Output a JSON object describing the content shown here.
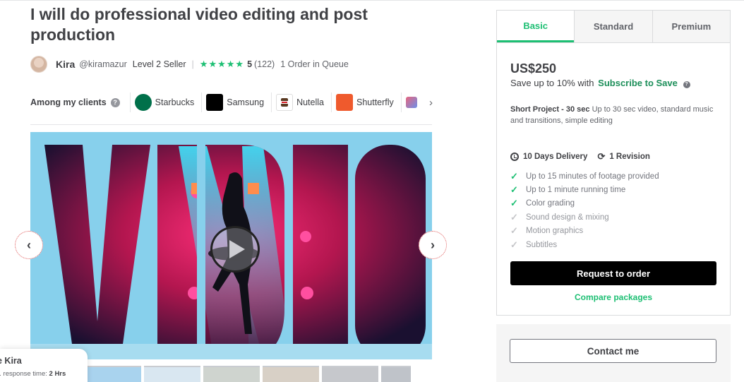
{
  "gig": {
    "title": "I will do professional video editing and post production"
  },
  "seller": {
    "name": "Kira",
    "handle": "@kiramazur",
    "level": "Level 2 Seller",
    "rating_stars": 5,
    "rating": "5",
    "reviews": "(122)",
    "queue": "1 Order in Queue"
  },
  "clients": {
    "label": "Among my clients",
    "items": [
      {
        "name": "Starbucks",
        "icon": "starbucks-logo"
      },
      {
        "name": "Samsung",
        "icon": "samsung-logo"
      },
      {
        "name": "Nutella",
        "icon": "nutella-logo"
      },
      {
        "name": "Shutterfly",
        "icon": "shutterfly-logo"
      }
    ]
  },
  "gallery": {
    "hero_word": "VIDEO"
  },
  "contact_card": {
    "name": "e Kira",
    "response_label": "g. response time:",
    "response_value": "2 Hrs"
  },
  "packages": {
    "tabs": [
      {
        "label": "Basic",
        "active": true
      },
      {
        "label": "Standard",
        "active": false
      },
      {
        "label": "Premium",
        "active": false
      }
    ],
    "price": "US$250",
    "save_prefix": "Save up to 10% with",
    "save_link": "Subscribe to Save",
    "title": "Short Project - 30 sec",
    "description": "Up to 30 sec video, standard music and transitions, simple editing",
    "delivery": "10 Days Delivery",
    "revisions": "1 Revision",
    "features": [
      {
        "label": "Up to 15 minutes of footage provided",
        "included": true
      },
      {
        "label": "Up to 1 minute running time",
        "included": true
      },
      {
        "label": "Color grading",
        "included": true
      },
      {
        "label": "Sound design & mixing",
        "included": false
      },
      {
        "label": "Motion graphics",
        "included": false
      },
      {
        "label": "Subtitles",
        "included": false
      }
    ],
    "order_button": "Request to order",
    "compare_link": "Compare packages"
  },
  "contact": {
    "button": "Contact me"
  },
  "colors": {
    "accent": "#1dbf73",
    "text": "#404145",
    "gallery_bg": "#87d0ec"
  }
}
